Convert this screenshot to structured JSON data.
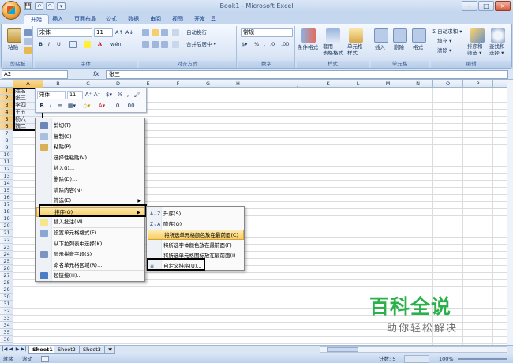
{
  "window": {
    "title": "Book1 - Microsoft Excel",
    "qat": [
      "💾",
      "↶",
      "↷",
      "▾"
    ],
    "controls": {
      "minimize": "–",
      "maximize": "□",
      "close": "×"
    }
  },
  "ribbon_tabs": [
    {
      "label": "开始",
      "active": true
    },
    {
      "label": "插入"
    },
    {
      "label": "页面布局"
    },
    {
      "label": "公式"
    },
    {
      "label": "数据"
    },
    {
      "label": "审阅"
    },
    {
      "label": "视图"
    },
    {
      "label": "开发工具"
    }
  ],
  "ribbon": {
    "clipboard": {
      "label": "剪贴板",
      "paste": "粘贴"
    },
    "font": {
      "label": "字体",
      "name": "宋体",
      "size": "11",
      "bold": "B",
      "italic": "I",
      "underline": "U",
      "grow": "A↑",
      "shrink": "A↓",
      "font_color": "A",
      "wen": "wén"
    },
    "alignment": {
      "label": "对齐方式",
      "wrap": "自动换行",
      "merge": "合并后居中 ▾"
    },
    "number": {
      "label": "数字",
      "format": "常规",
      "percent": "%",
      "comma": ",",
      "inc": ".0",
      "dec": ".00",
      "currency": "$▾"
    },
    "styles": {
      "label": "样式",
      "conditional": "条件格式",
      "as_table": "套用\n表格格式",
      "cell_styles": "单元格\n样式"
    },
    "cells": {
      "label": "单元格",
      "insert": "插入",
      "delete": "删除",
      "format": "格式"
    },
    "editing": {
      "label": "编辑",
      "autosum": "Σ 自动求和 ▾",
      "fill": "填充 ▾",
      "clear": "清除 ▾",
      "sort_filter": "排序和\n筛选 ▾",
      "find_select": "查找和\n选择 ▾"
    }
  },
  "formula_bar": {
    "name_box": "A2",
    "fx": "fx",
    "value": "张三"
  },
  "columns": [
    "A",
    "B",
    "C",
    "D",
    "E",
    "F",
    "G",
    "H",
    "I",
    "J",
    "K",
    "L",
    "M",
    "N",
    "O",
    "P"
  ],
  "rows": [
    "1",
    "2",
    "3",
    "4",
    "5",
    "6",
    "7",
    "8",
    "9",
    "10",
    "11",
    "12",
    "13",
    "14",
    "15",
    "16",
    "17",
    "18",
    "19",
    "20",
    "21",
    "22",
    "23",
    "24",
    "25",
    "26",
    "27",
    "28",
    "29",
    "30",
    "31",
    "32",
    "33",
    "34",
    "35",
    "36"
  ],
  "cells_a": [
    "姓名",
    "张三",
    "李四",
    "王五",
    "杨六",
    "魏二"
  ],
  "mini_toolbar": {
    "font": "宋体",
    "size": "11",
    "grow": "A⁺",
    "shrink": "A⁻",
    "currency": "$▾",
    "percent": "%",
    "comma": ",",
    "brush": "🖌",
    "bold": "B",
    "italic": "I",
    "align": "≡",
    "border": "▦▾",
    "fill": "◇▾",
    "color": "A▾",
    "dec1": ".0",
    "dec2": ".00"
  },
  "context_menu": [
    {
      "label": "剪切(T)",
      "icon": "cut-icon"
    },
    {
      "label": "复制(C)",
      "icon": "copy-icon"
    },
    {
      "label": "粘贴(P)",
      "icon": "paste-icon"
    },
    {
      "label": "选择性粘贴(V)...",
      "icon": ""
    },
    {
      "label": "插入(I)...",
      "icon": ""
    },
    {
      "label": "删除(D)...",
      "icon": ""
    },
    {
      "label": "清除内容(N)",
      "icon": ""
    },
    {
      "label": "筛选(E)",
      "icon": "",
      "submenu": true
    },
    {
      "label": "排序(O)",
      "icon": "",
      "submenu": true,
      "highlighted": true
    },
    {
      "label": "插入批注(M)",
      "icon": "comment-icon"
    },
    {
      "label": "设置单元格格式(F)...",
      "icon": "format-cells-icon"
    },
    {
      "label": "从下拉列表中选择(K)...",
      "icon": ""
    },
    {
      "label": "显示拼音字段(S)",
      "icon": "phonetic-icon"
    },
    {
      "label": "命名单元格区域(R)...",
      "icon": ""
    },
    {
      "label": "超链接(H)...",
      "icon": "hyperlink-icon"
    }
  ],
  "sort_submenu": [
    {
      "label": "升序(S)",
      "icon": "A↓Z"
    },
    {
      "label": "降序(O)",
      "icon": "Z↓A"
    },
    {
      "label": "将所选单元格颜色放在最前面(C)",
      "highlighted": true
    },
    {
      "label": "将所选字体颜色放在最前面(F)"
    },
    {
      "label": "将所选单元格图标放在最前面(I)"
    },
    {
      "label": "自定义排序(U)...",
      "icon": "≡"
    }
  ],
  "sheets": [
    "Sheet1",
    "Sheet2",
    "Sheet3"
  ],
  "status": {
    "ready": "就绪",
    "mode": "滚动",
    "count_label": "计数: 5",
    "zoom": "100%"
  },
  "watermark": {
    "main": "百科全说",
    "sub": "助你轻松解决"
  }
}
